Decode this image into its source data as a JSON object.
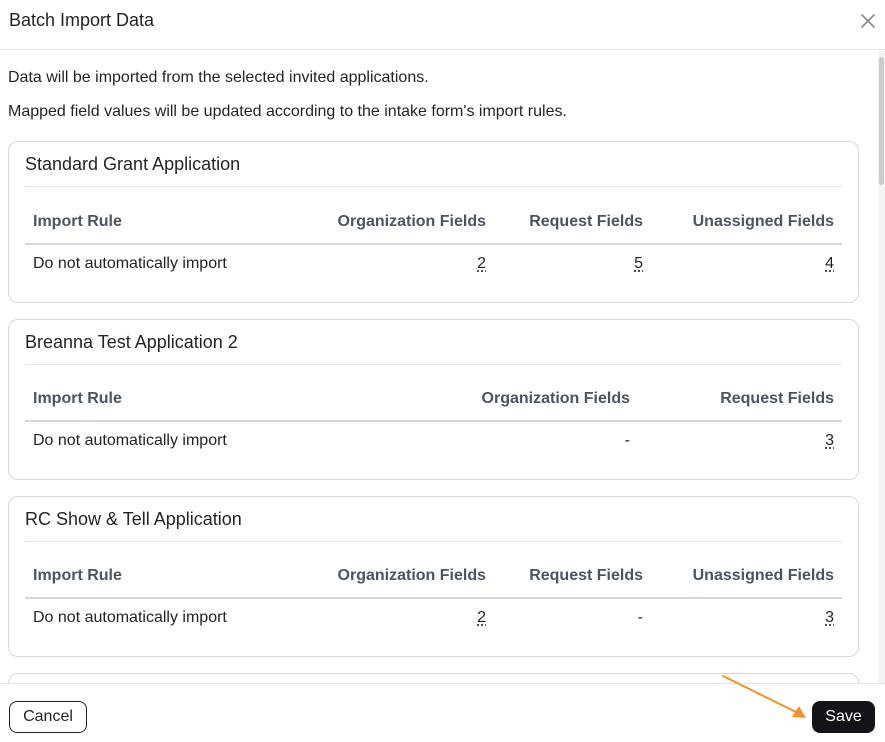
{
  "dialog": {
    "title": "Batch Import Data",
    "close_icon": "close-icon"
  },
  "intro": {
    "line1": "Data will be imported from the selected invited applications.",
    "line2": "Mapped field values will be updated according to the intake form's import rules."
  },
  "cards": [
    {
      "title": "Standard Grant Application",
      "headers": [
        "Import Rule",
        "Organization Fields",
        "Request Fields",
        "Unassigned Fields"
      ],
      "row": [
        "Do not automatically import",
        "2",
        "5",
        "4"
      ]
    },
    {
      "title": "Breanna Test Application 2",
      "headers": [
        "Import Rule",
        "Organization Fields",
        "Request Fields"
      ],
      "row": [
        "Do not automatically import",
        "-",
        "3"
      ]
    },
    {
      "title": "RC Show & Tell Application",
      "headers": [
        "Import Rule",
        "Organization Fields",
        "Request Fields",
        "Unassigned Fields"
      ],
      "row": [
        "Do not automatically import",
        "2",
        "-",
        "3"
      ]
    }
  ],
  "footer": {
    "cancel_label": "Cancel",
    "save_label": "Save"
  },
  "colors": {
    "primary_button": "#111418",
    "annotation_arrow": "#f0932b"
  }
}
